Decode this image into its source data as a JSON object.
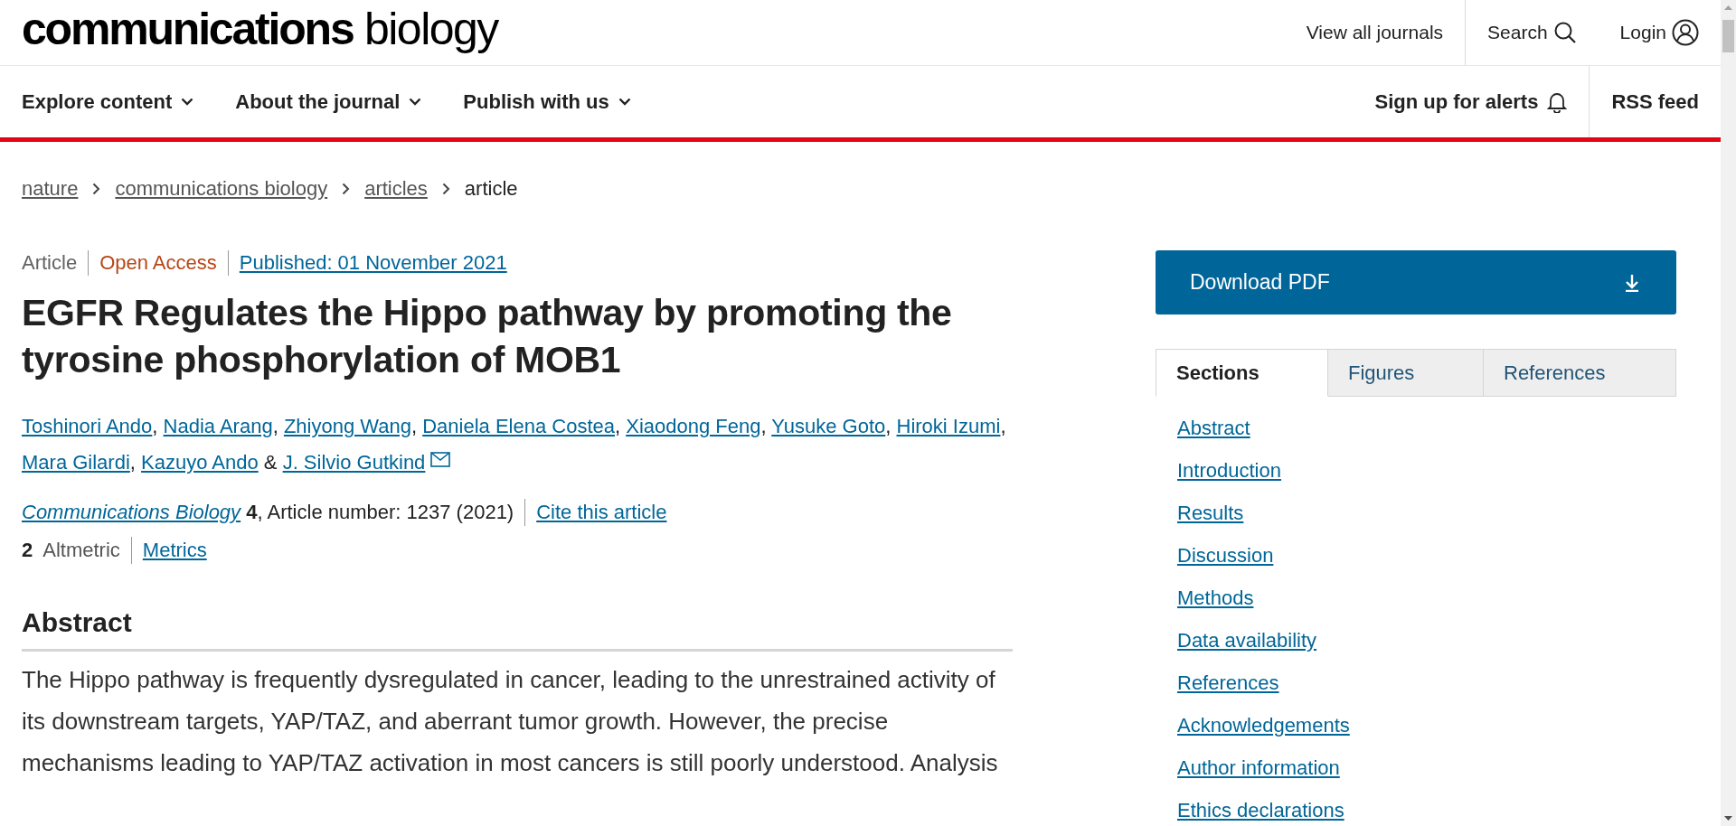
{
  "header": {
    "logo": {
      "bold": "communications",
      "light": "biology"
    },
    "links": [
      {
        "label": "View all journals"
      },
      {
        "label": "Search"
      },
      {
        "label": "Login"
      }
    ]
  },
  "nav": {
    "menus": [
      {
        "label": "Explore content"
      },
      {
        "label": "About the journal"
      },
      {
        "label": "Publish with us"
      }
    ],
    "actions": [
      {
        "label": "Sign up for alerts"
      },
      {
        "label": "RSS feed"
      }
    ]
  },
  "breadcrumbs": [
    {
      "label": "nature",
      "current": false
    },
    {
      "label": "communications biology",
      "current": false
    },
    {
      "label": "articles",
      "current": false
    },
    {
      "label": "article",
      "current": true
    }
  ],
  "article": {
    "meta": [
      {
        "kind": "type",
        "label": "Article"
      },
      {
        "kind": "access",
        "label": "Open Access"
      },
      {
        "kind": "date",
        "label": "Published: 01 November 2021"
      }
    ],
    "title": "EGFR Regulates the Hippo pathway by promoting the tyrosine phosphorylation of MOB1",
    "authors": [
      {
        "name": "Toshinori Ando",
        "sep": ", ",
        "contact": false
      },
      {
        "name": "Nadia Arang",
        "sep": ", ",
        "contact": false
      },
      {
        "name": "Zhiyong Wang",
        "sep": ", ",
        "contact": false
      },
      {
        "name": "Daniela Elena Costea",
        "sep": ", ",
        "contact": false
      },
      {
        "name": "Xiaodong Feng",
        "sep": ", ",
        "contact": false
      },
      {
        "name": "Yusuke Goto",
        "sep": ", ",
        "contact": false
      },
      {
        "name": "Hiroki Izumi",
        "sep": ", ",
        "contact": false
      },
      {
        "name": "Mara Gilardi",
        "sep": ", ",
        "contact": false
      },
      {
        "name": "Kazuyo Ando",
        "sep": " & ",
        "contact": false
      },
      {
        "name": "J. Silvio Gutkind",
        "contact": true
      }
    ],
    "journal": "Communications Biology",
    "citation": "**4**, Article number: 1237 (2021)",
    "cite_link": "Cite this article",
    "altmetric": "**2**  Altmetric",
    "metrics_link": "Metrics",
    "abstract": {
      "heading": "Abstract",
      "text": "The Hippo pathway is frequently dysregulated in cancer, leading to the unrestrained activity of its downstream targets, YAP/TAZ, and aberrant tumor growth. However, the precise mechanisms leading to YAP/TAZ activation in most cancers is still poorly understood. Analysis"
    }
  },
  "sidebar": {
    "download": "Download PDF",
    "tabs": [
      {
        "label": "Sections",
        "selected": true
      },
      {
        "label": "Figures",
        "selected": false
      },
      {
        "label": "References",
        "selected": false
      }
    ],
    "sections": [
      "Abstract",
      "Introduction",
      "Results",
      "Discussion",
      "Methods",
      "Data availability",
      "References",
      "Acknowledgements",
      "Author information",
      "Ethics declarations"
    ]
  }
}
